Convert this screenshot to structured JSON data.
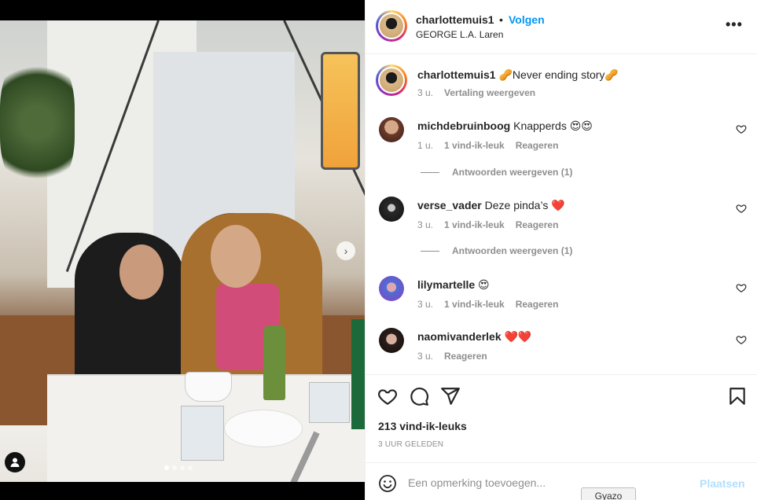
{
  "post": {
    "carousel": {
      "dots": [
        true,
        false,
        false,
        false
      ]
    }
  },
  "header": {
    "username": "charlottemuis1",
    "bullet": "•",
    "follow_label": "Volgen",
    "location": "GEORGE L.A. Laren",
    "more_label": "•••"
  },
  "caption": {
    "username": "charlottemuis1",
    "text": "🥜Never ending story🥜",
    "time": "3 u.",
    "translate_label": "Vertaling weergeven"
  },
  "comments": [
    {
      "username": "michdebruinboog",
      "text": "Knapperds 😍😍",
      "time": "1 u.",
      "likes": "1 vind-ik-leuk",
      "reply_label": "Reageren",
      "replies_label": "Antwoorden weergeven (1)"
    },
    {
      "username": "verse_vader",
      "text": "Deze pinda’s ❤️",
      "time": "3 u.",
      "likes": "1 vind-ik-leuk",
      "reply_label": "Reageren",
      "replies_label": "Antwoorden weergeven (1)"
    },
    {
      "username": "lilymartelle",
      "text": "😍",
      "time": "3 u.",
      "likes": "1 vind-ik-leuk",
      "reply_label": "Reageren"
    },
    {
      "username": "naomivanderlek",
      "text": "❤️❤️",
      "time": "3 u.",
      "reply_label": "Reageren"
    }
  ],
  "stats": {
    "likes": "213 vind-ik-leuks",
    "time_ago": "3 UUR GELEDEN"
  },
  "add_comment": {
    "placeholder": "Een opmerking toevoegen...",
    "post_label": "Plaatsen"
  },
  "overlay": {
    "gyazo_label": "Gyazo"
  },
  "colors": {
    "accent": "#0095f6",
    "post_disabled": "#b2dffc",
    "muted": "#8e8e8e",
    "text": "#262626"
  },
  "icons": [
    "next-arrow-icon",
    "user-tag-icon",
    "more-icon",
    "heart-icon",
    "comment-icon",
    "share-icon",
    "bookmark-icon",
    "emoji-icon"
  ]
}
